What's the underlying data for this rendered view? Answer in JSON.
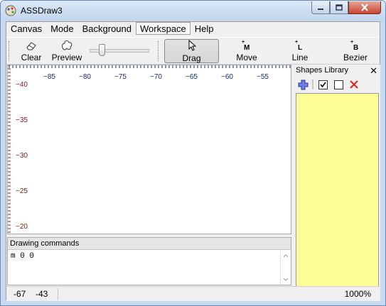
{
  "window": {
    "title": "ASSDraw3"
  },
  "menu": [
    "Canvas",
    "Mode",
    "Background",
    "Workspace",
    "Help"
  ],
  "toolbar": {
    "clear": "Clear",
    "preview": "Preview",
    "zoom_slider_level": 0.18,
    "modes": [
      {
        "label": "Drag",
        "icon": "cursor-arrow-icon",
        "pressed": true
      },
      {
        "label": "Move",
        "icon": "move-M-icon"
      },
      {
        "label": "Line",
        "icon": "line-L-icon"
      },
      {
        "label": "Bezier",
        "icon": "bezier-B-icon"
      }
    ]
  },
  "canvas": {
    "ruler_top": [
      "−85",
      "−80",
      "−75",
      "−70",
      "−65",
      "−60",
      "−55"
    ],
    "ruler_left": [
      "−40",
      "−35",
      "−30",
      "−25",
      "−20"
    ],
    "x_axis_color": "#1c2a6e",
    "y_axis_color": "#7a1e1e"
  },
  "shapes_library": {
    "title": "Shapes Library",
    "close": "✕",
    "area_color": "#fdfd96"
  },
  "drawing_commands": {
    "title": "Drawing commands",
    "text": "m 0 0"
  },
  "status": {
    "x": "-67",
    "y": "-43",
    "zoom": "1000%"
  }
}
